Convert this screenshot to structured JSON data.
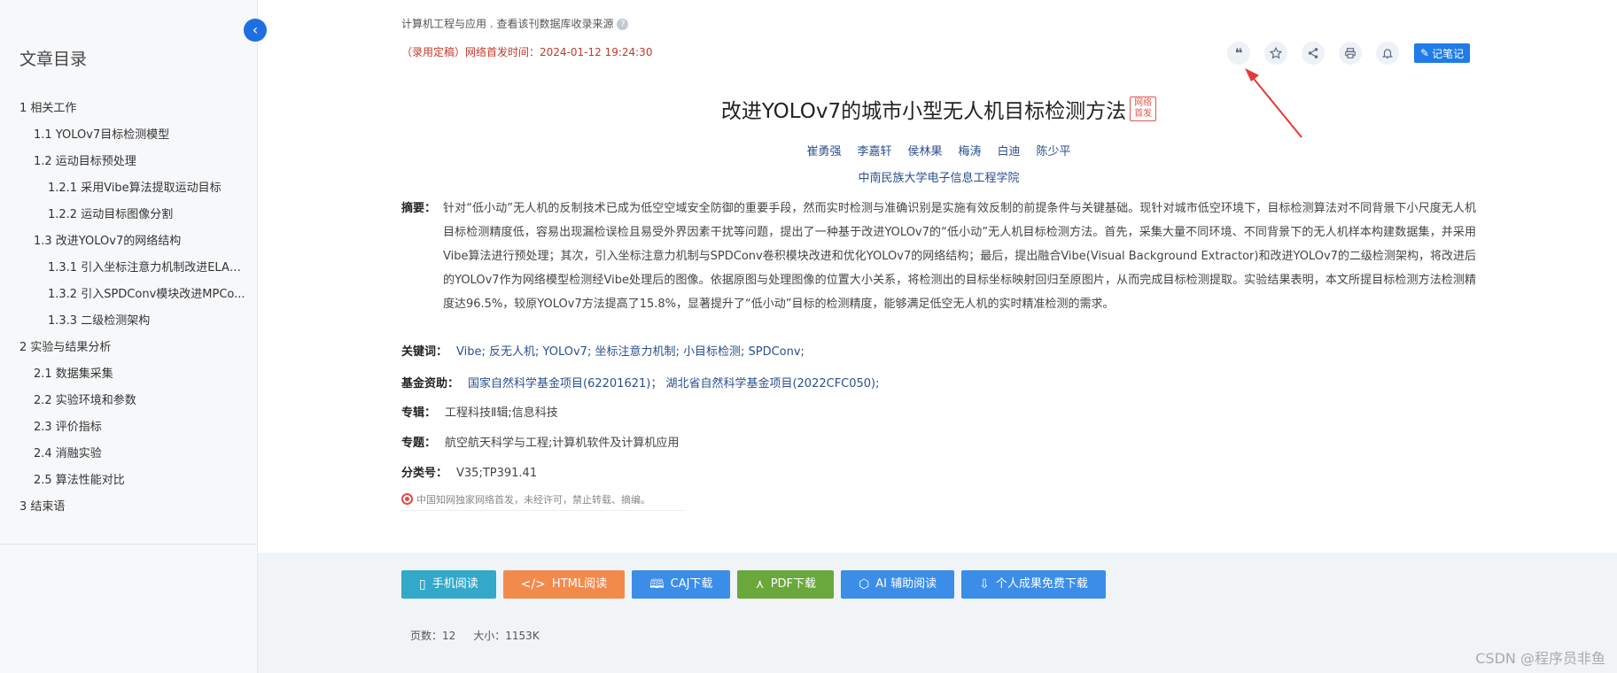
{
  "sidebar": {
    "title": "文章目录",
    "items": [
      {
        "label": "1 相关工作",
        "level": 1
      },
      {
        "label": "1.1 YOLOv7目标检测模型",
        "level": 2
      },
      {
        "label": "1.2 运动目标预处理",
        "level": 2
      },
      {
        "label": "1.2.1 采用Vibe算法提取运动目标",
        "level": 3
      },
      {
        "label": "1.2.2 运动目标图像分割",
        "level": 3
      },
      {
        "label": "1.3 改进YOLOv7的网络结构",
        "level": 2
      },
      {
        "label": "1.3.1 引入坐标注意力机制改进ELAN...",
        "level": 3
      },
      {
        "label": "1.3.2 引入SPDConv模块改进MPCo...",
        "level": 3
      },
      {
        "label": "1.3.3 二级检测架构",
        "level": 3
      },
      {
        "label": "2 实验与结果分析",
        "level": 1
      },
      {
        "label": "2.1 数据集采集",
        "level": 2
      },
      {
        "label": "2.2 实验环境和参数",
        "level": 2
      },
      {
        "label": "2.3 评价指标",
        "level": 2
      },
      {
        "label": "2.4 消融实验",
        "level": 2
      },
      {
        "label": "2.5 算法性能对比",
        "level": 2
      },
      {
        "label": "3 结束语",
        "level": 1
      }
    ]
  },
  "header": {
    "source": "计算机工程与应用 . 查看该刊数据库收录来源",
    "help_glyph": "?",
    "pub_info": "（录用定稿）网络首发时间：2024-01-12 19:24:30",
    "note_label": "记笔记",
    "note_glyph": "✎",
    "cite_glyph": "❝"
  },
  "article": {
    "title": "改进YOLOv7的城市小型无人机目标检测方法",
    "first_badge": "网络首发",
    "authors": [
      "崔勇强",
      "李嘉轩",
      "侯林果",
      "梅涛",
      "白迪",
      "陈少平"
    ],
    "org": "中南民族大学电子信息工程学院",
    "abstract_label": "摘要：",
    "abstract": "针对“低小动”无人机的反制技术已成为低空空域安全防御的重要手段，然而实时检测与准确识别是实施有效反制的前提条件与关键基础。现针对城市低空环境下，目标检测算法对不同背景下小尺度无人机目标检测精度低，容易出现漏检误检且易受外界因素干扰等问题，提出了一种基于改进YOLOv7的“低小动”无人机目标检测方法。首先，采集大量不同环境、不同背景下的无人机样本构建数据集，并采用Vibe算法进行预处理；其次，引入坐标注意力机制与SPDConv卷积模块改进和优化YOLOv7的网络结构；最后，提出融合Vibe(Visual Background Extractor)和改进YOLOv7的二级检测架构，将改进后的YOLOv7作为网络模型检测经Vibe处理后的图像。依据原图与处理图像的位置大小关系，将检测出的目标坐标映射回归至原图片，从而完成目标检测提取。实验结果表明，本文所提目标检测方法检测精度达96.5%，较原YOLOv7方法提高了15.8%，显著提升了“低小动”目标的检测精度，能够满足低空无人机的实时精准检测的需求。",
    "keywords_label": "关键词：",
    "keywords": "Vibe;  反无人机;  YOLOv7;  坐标注意力机制;  小目标检测;  SPDConv;",
    "fund_label": "基金资助：",
    "fund": "国家自然科学基金项目(62201621)；  湖北省自然科学基金项目(2022CFC050);",
    "series_label": "专辑：",
    "series": "工程科技Ⅱ辑;信息科技",
    "topic_label": "专题：",
    "topic": "航空航天科学与工程;计算机软件及计算机应用",
    "class_label": "分类号：",
    "class": "V35;TP391.41",
    "copyright": "中国知网独家网络首发，未经许可，禁止转载、摘编。"
  },
  "actions": [
    {
      "label": "手机阅读",
      "icon": "▯",
      "color": "#33a8c9",
      "name": "mobile-read-button",
      "icon_name": "phone-icon"
    },
    {
      "label": "HTML阅读",
      "icon": "</>",
      "color": "#f28a4c",
      "name": "html-read-button",
      "icon_name": "code-icon"
    },
    {
      "label": "CAJ下载",
      "icon": "🕮",
      "color": "#3b8de8",
      "name": "caj-download-button",
      "icon_name": "book-icon"
    },
    {
      "label": "PDF下载",
      "icon": "⋏",
      "color": "#6aa83c",
      "name": "pdf-download-button",
      "icon_name": "pdf-icon"
    },
    {
      "label": "AI 辅助阅读",
      "icon": "⬡",
      "color": "#3b8de8",
      "name": "ai-read-button",
      "icon_name": "ai-icon"
    },
    {
      "label": "个人成果免费下载",
      "icon": "⇩",
      "color": "#3b8de8",
      "name": "free-download-button",
      "icon_name": "download-icon"
    }
  ],
  "meta": {
    "pages": "页数：12",
    "size": "大小：1153K"
  },
  "watermark": "CSDN @程序员非鱼",
  "colors": {
    "accent": "#1f7ce8",
    "link": "#2a4f8f",
    "pub_red": "#c0392b",
    "arrow_red": "#e53935"
  }
}
